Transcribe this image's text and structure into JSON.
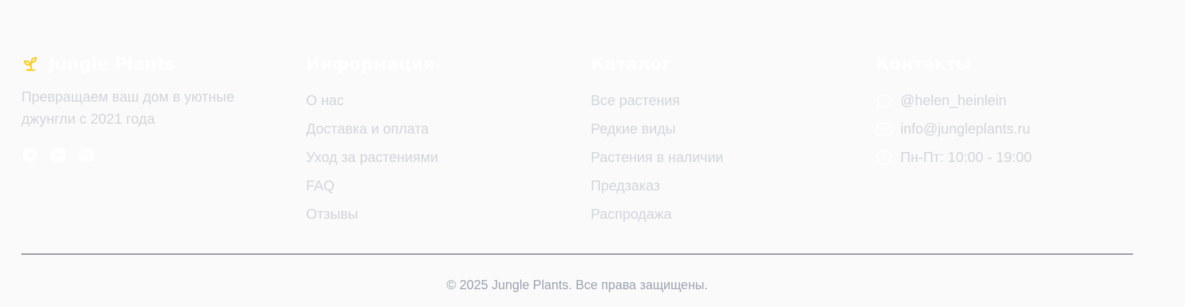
{
  "colors": {
    "background": "#fafafa",
    "heading": "#ffffff",
    "text": "#d1d5db",
    "muted": "#9ca3af",
    "accent": "#facc15",
    "divider": "#374151"
  },
  "brand": {
    "icon": "sprout-icon",
    "name": "Jungle Plants",
    "tagline": "Превращаем ваш дом в уютные джунгли с 2021 года",
    "socials": [
      {
        "icon": "telegram-icon"
      },
      {
        "icon": "vk-icon"
      },
      {
        "icon": "mail-icon"
      }
    ]
  },
  "info": {
    "title": "Информация",
    "links": [
      "О нас",
      "Доставка и оплата",
      "Уход за растениями",
      "FAQ",
      "Отзывы"
    ]
  },
  "catalog": {
    "title": "Каталог",
    "links": [
      "Все растения",
      "Редкие виды",
      "Растения в наличии",
      "Предзаказ",
      "Распродажа"
    ]
  },
  "contacts": {
    "title": "Контакты",
    "items": [
      {
        "icon": "chat-bubble-icon",
        "text": "@helen_heinlein"
      },
      {
        "icon": "mail-icon",
        "text": "info@jungleplants.ru"
      },
      {
        "icon": "clock-icon",
        "text": "Пн-Пт: 10:00 - 19:00"
      }
    ]
  },
  "copyright": "© 2025 Jungle Plants. Все права защищены."
}
